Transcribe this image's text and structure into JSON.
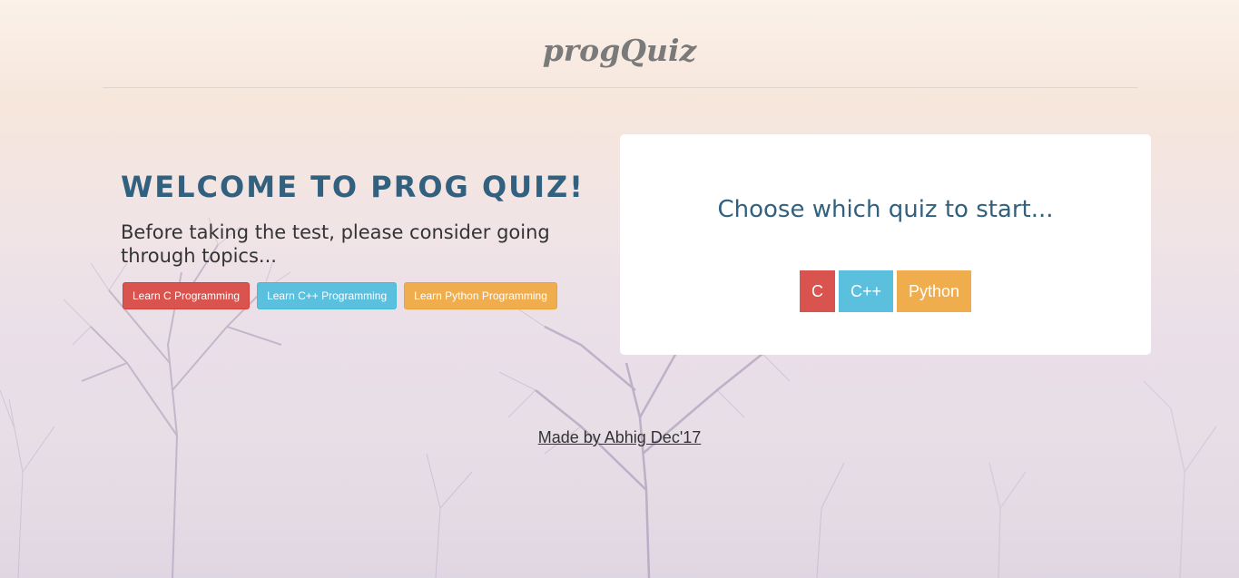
{
  "header": {
    "brand": "progQuiz"
  },
  "welcome": {
    "title": "Welcome to Prog Quiz!",
    "text": "Before taking the test, please consider going through topics..."
  },
  "learn_buttons": [
    {
      "label": "Learn C Programming",
      "color": "#d9534f"
    },
    {
      "label": "Learn C++ Programming",
      "color": "#5bc0de"
    },
    {
      "label": "Learn Python Programming",
      "color": "#f0ad4e"
    }
  ],
  "quiz_card": {
    "title": "Choose which quiz to start...",
    "buttons": [
      {
        "label": "C",
        "color": "#d9534f"
      },
      {
        "label": "C++",
        "color": "#5bc0de"
      },
      {
        "label": "Python",
        "color": "#f0ad4e"
      }
    ]
  },
  "footer": {
    "credit": "Made by Abhig Dec'17"
  },
  "colors": {
    "accent": "#32617f",
    "brand_text": "#7a7a7a"
  }
}
